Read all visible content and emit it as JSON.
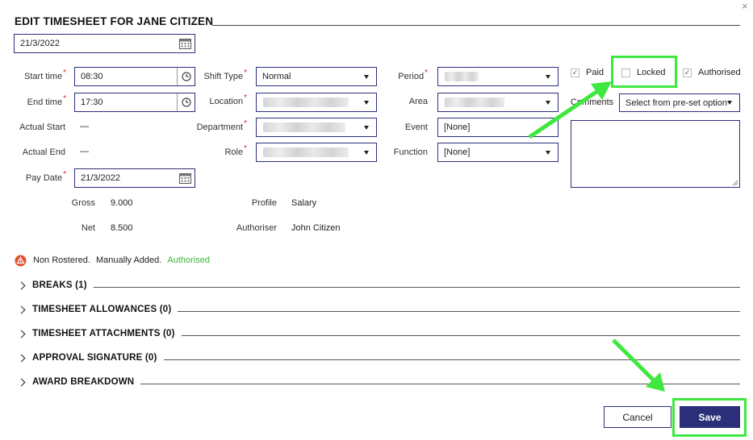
{
  "header": {
    "title": "EDIT TIMESHEET FOR JANE CITIZEN",
    "close": "×"
  },
  "date": {
    "value": "21/3/2022"
  },
  "col1": {
    "start_time_label": "Start time",
    "start_time_value": "08:30",
    "end_time_label": "End time",
    "end_time_value": "17:30",
    "actual_start_label": "Actual Start",
    "actual_start_value": "—",
    "actual_end_label": "Actual End",
    "actual_end_value": "—",
    "pay_date_label": "Pay Date",
    "pay_date_value": "21/3/2022",
    "gross_label": "Gross",
    "gross_value": "9.000",
    "net_label": "Net",
    "net_value": "8.500"
  },
  "col2": {
    "shift_type_label": "Shift Type",
    "shift_type_value": "Normal",
    "location_label": "Location",
    "department_label": "Department",
    "role_label": "Role",
    "profile_label": "Profile",
    "profile_value": "Salary",
    "authoriser_label": "Authoriser",
    "authoriser_value": "John Citizen"
  },
  "col3": {
    "period_label": "Period",
    "area_label": "Area",
    "event_label": "Event",
    "event_value": "[None]",
    "function_label": "Function",
    "function_value": "[None]"
  },
  "col4": {
    "paid_label": "Paid",
    "locked_label": "Locked",
    "authorised_label": "Authorised",
    "comments_label": "Comments",
    "comments_select": "Select from pre-set option"
  },
  "status": {
    "non_rostered": "Non Rostered.",
    "manually_added": "Manually Added.",
    "authorised": "Authorised"
  },
  "sections": [
    {
      "label": "BREAKS (1)"
    },
    {
      "label": "TIMESHEET ALLOWANCES (0)"
    },
    {
      "label": "TIMESHEET ATTACHMENTS (0)"
    },
    {
      "label": "APPROVAL SIGNATURE (0)"
    },
    {
      "label": "AWARD BREAKDOWN"
    }
  ],
  "footer": {
    "cancel_label": "Cancel",
    "save_label": "Save"
  },
  "colors": {
    "primary": "#2b2f7a",
    "highlight": "#3ee83e",
    "authorised": "#3cb83c",
    "required": "#dd2222",
    "warning": "#e4532f"
  },
  "state": {
    "paid": true,
    "locked": false,
    "authorised": true
  }
}
